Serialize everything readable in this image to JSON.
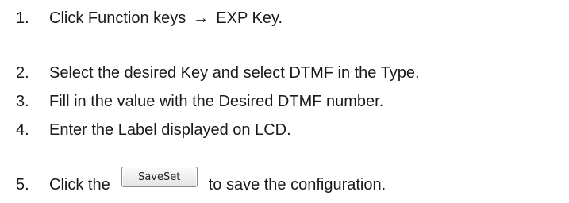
{
  "steps": [
    {
      "num": "1.",
      "text_before": "Click Function keys",
      "arrow": "→",
      "text_after": "EXP Key."
    },
    {
      "num": "2.",
      "text": "Select the desired Key and select DTMF in the Type."
    },
    {
      "num": "3.",
      "text": "Fill in the value with the Desired DTMF number."
    },
    {
      "num": "4.",
      "text": "Enter the Label displayed on LCD."
    },
    {
      "num": "5.",
      "text_before": "Click the",
      "button_label": "SaveSet",
      "text_after": "to save the configuration."
    }
  ]
}
